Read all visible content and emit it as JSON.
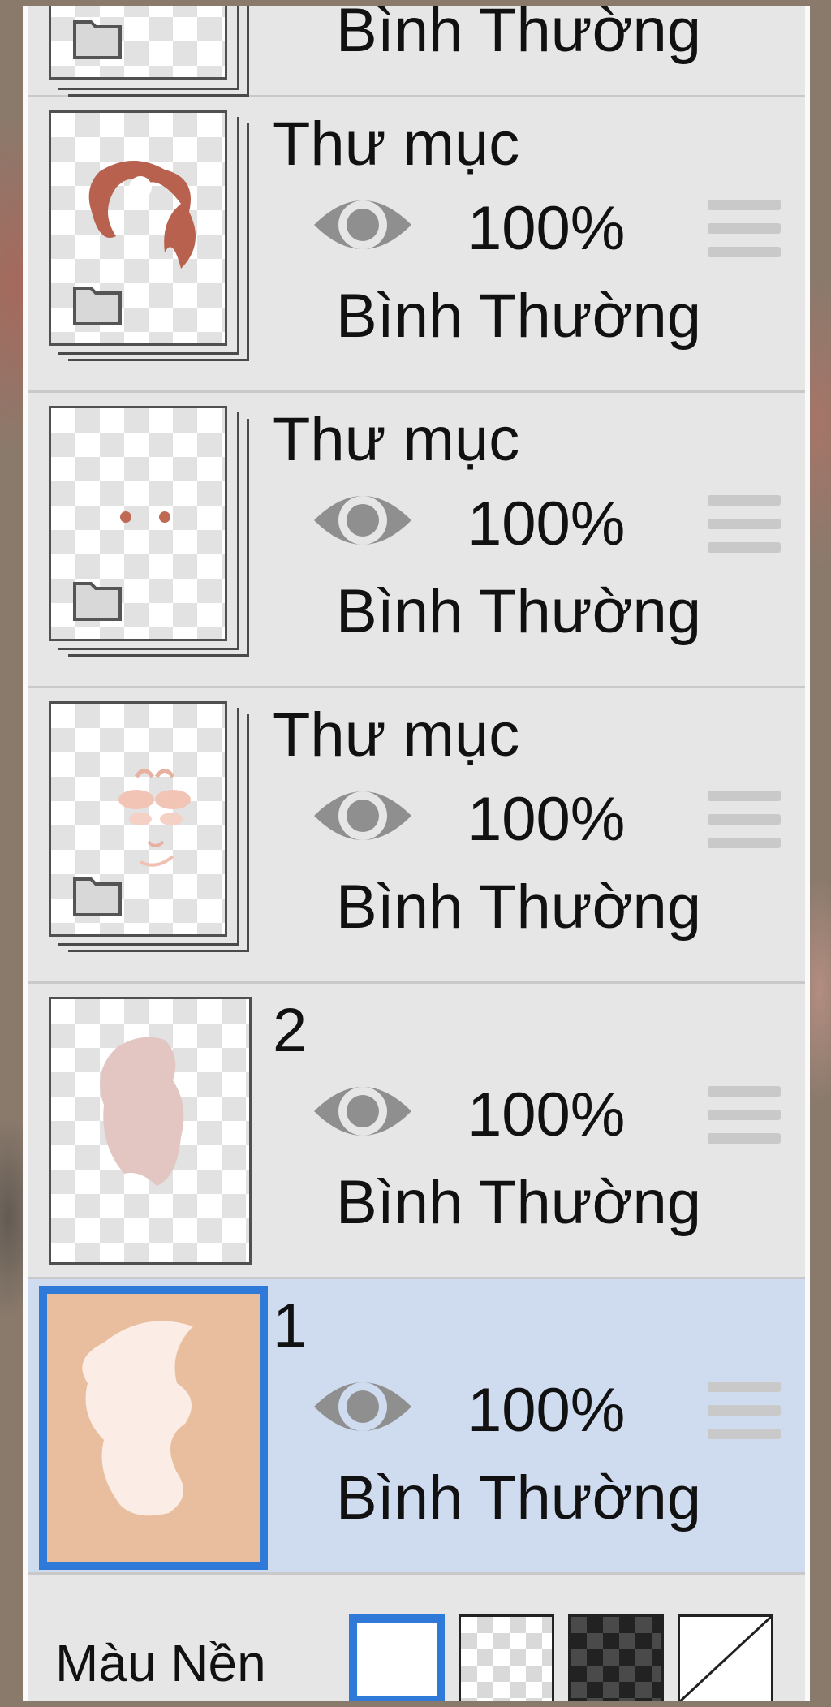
{
  "layers": [
    {
      "name": "",
      "opacity": "",
      "blend": "Bình Thường",
      "type": "folder",
      "partial": true
    },
    {
      "name": "Thư mục",
      "opacity": "100%",
      "blend": "Bình Thường",
      "type": "folder",
      "visible": true
    },
    {
      "name": "Thư mục",
      "opacity": "100%",
      "blend": "Bình Thường",
      "type": "folder",
      "visible": true
    },
    {
      "name": "Thư mục",
      "opacity": "100%",
      "blend": "Bình Thường",
      "type": "folder",
      "visible": true
    },
    {
      "name": "2",
      "opacity": "100%",
      "blend": "Bình Thường",
      "type": "layer",
      "visible": true
    },
    {
      "name": "1",
      "opacity": "100%",
      "blend": "Bình Thường",
      "type": "layer",
      "visible": true,
      "selected": true
    }
  ],
  "background": {
    "label": "Màu Nền",
    "options": [
      "white",
      "light-checker",
      "dark-checker",
      "none"
    ],
    "selected": "white"
  },
  "colors": {
    "accent": "#2f7ad9",
    "selected_row": "#cfdcef",
    "panel": "#e6e6e6",
    "icon_gray": "#8f8f8f",
    "handle_gray": "#c9c9c9"
  }
}
